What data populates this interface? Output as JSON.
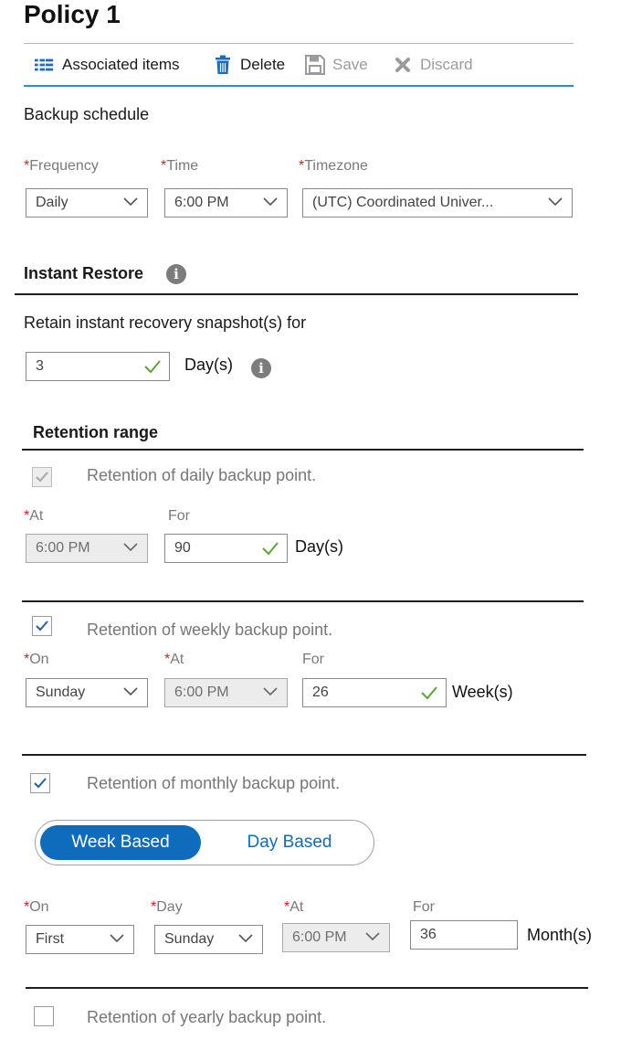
{
  "title": "Policy 1",
  "toolbar": {
    "associated_items": "Associated items",
    "delete": "Delete",
    "save": "Save",
    "discard": "Discard"
  },
  "backup_schedule": {
    "heading": "Backup schedule",
    "frequency_label": "Frequency",
    "frequency_value": "Daily",
    "time_label": "Time",
    "time_value": "6:00 PM",
    "timezone_label": "Timezone",
    "timezone_value": "(UTC) Coordinated Univer..."
  },
  "instant_restore": {
    "heading": "Instant Restore",
    "retain_label": "Retain instant recovery snapshot(s) for",
    "retain_value": "3",
    "unit": "Day(s)"
  },
  "retention": {
    "heading": "Retention range",
    "daily": {
      "label": "Retention of daily backup point.",
      "checked": true,
      "disabled": true,
      "at_label": "At",
      "at_value": "6:00 PM",
      "for_label": "For",
      "for_value": "90",
      "unit": "Day(s)"
    },
    "weekly": {
      "label": "Retention of weekly backup point.",
      "checked": true,
      "on_label": "On",
      "on_value": "Sunday",
      "at_label": "At",
      "at_value": "6:00 PM",
      "for_label": "For",
      "for_value": "26",
      "unit": "Week(s)"
    },
    "monthly": {
      "label": "Retention of monthly backup point.",
      "checked": true,
      "toggle_selected": "Week Based",
      "toggle_other": "Day Based",
      "on_label": "On",
      "on_value": "First",
      "day_label": "Day",
      "day_value": "Sunday",
      "at_label": "At",
      "at_value": "6:00 PM",
      "for_label": "For",
      "for_value": "36",
      "unit": "Month(s)"
    },
    "yearly": {
      "label": "Retention of yearly backup point.",
      "checked": false
    }
  },
  "colors": {
    "accent": "#0f6cbd",
    "required": "#d42020",
    "valid_check": "#5aa532"
  },
  "icons": {
    "associated": "list-icon",
    "delete": "trash-icon",
    "save": "save-icon",
    "discard": "close-icon",
    "info": "info-icon",
    "chevron": "chevron-down-icon",
    "valid": "checkmark-icon"
  }
}
